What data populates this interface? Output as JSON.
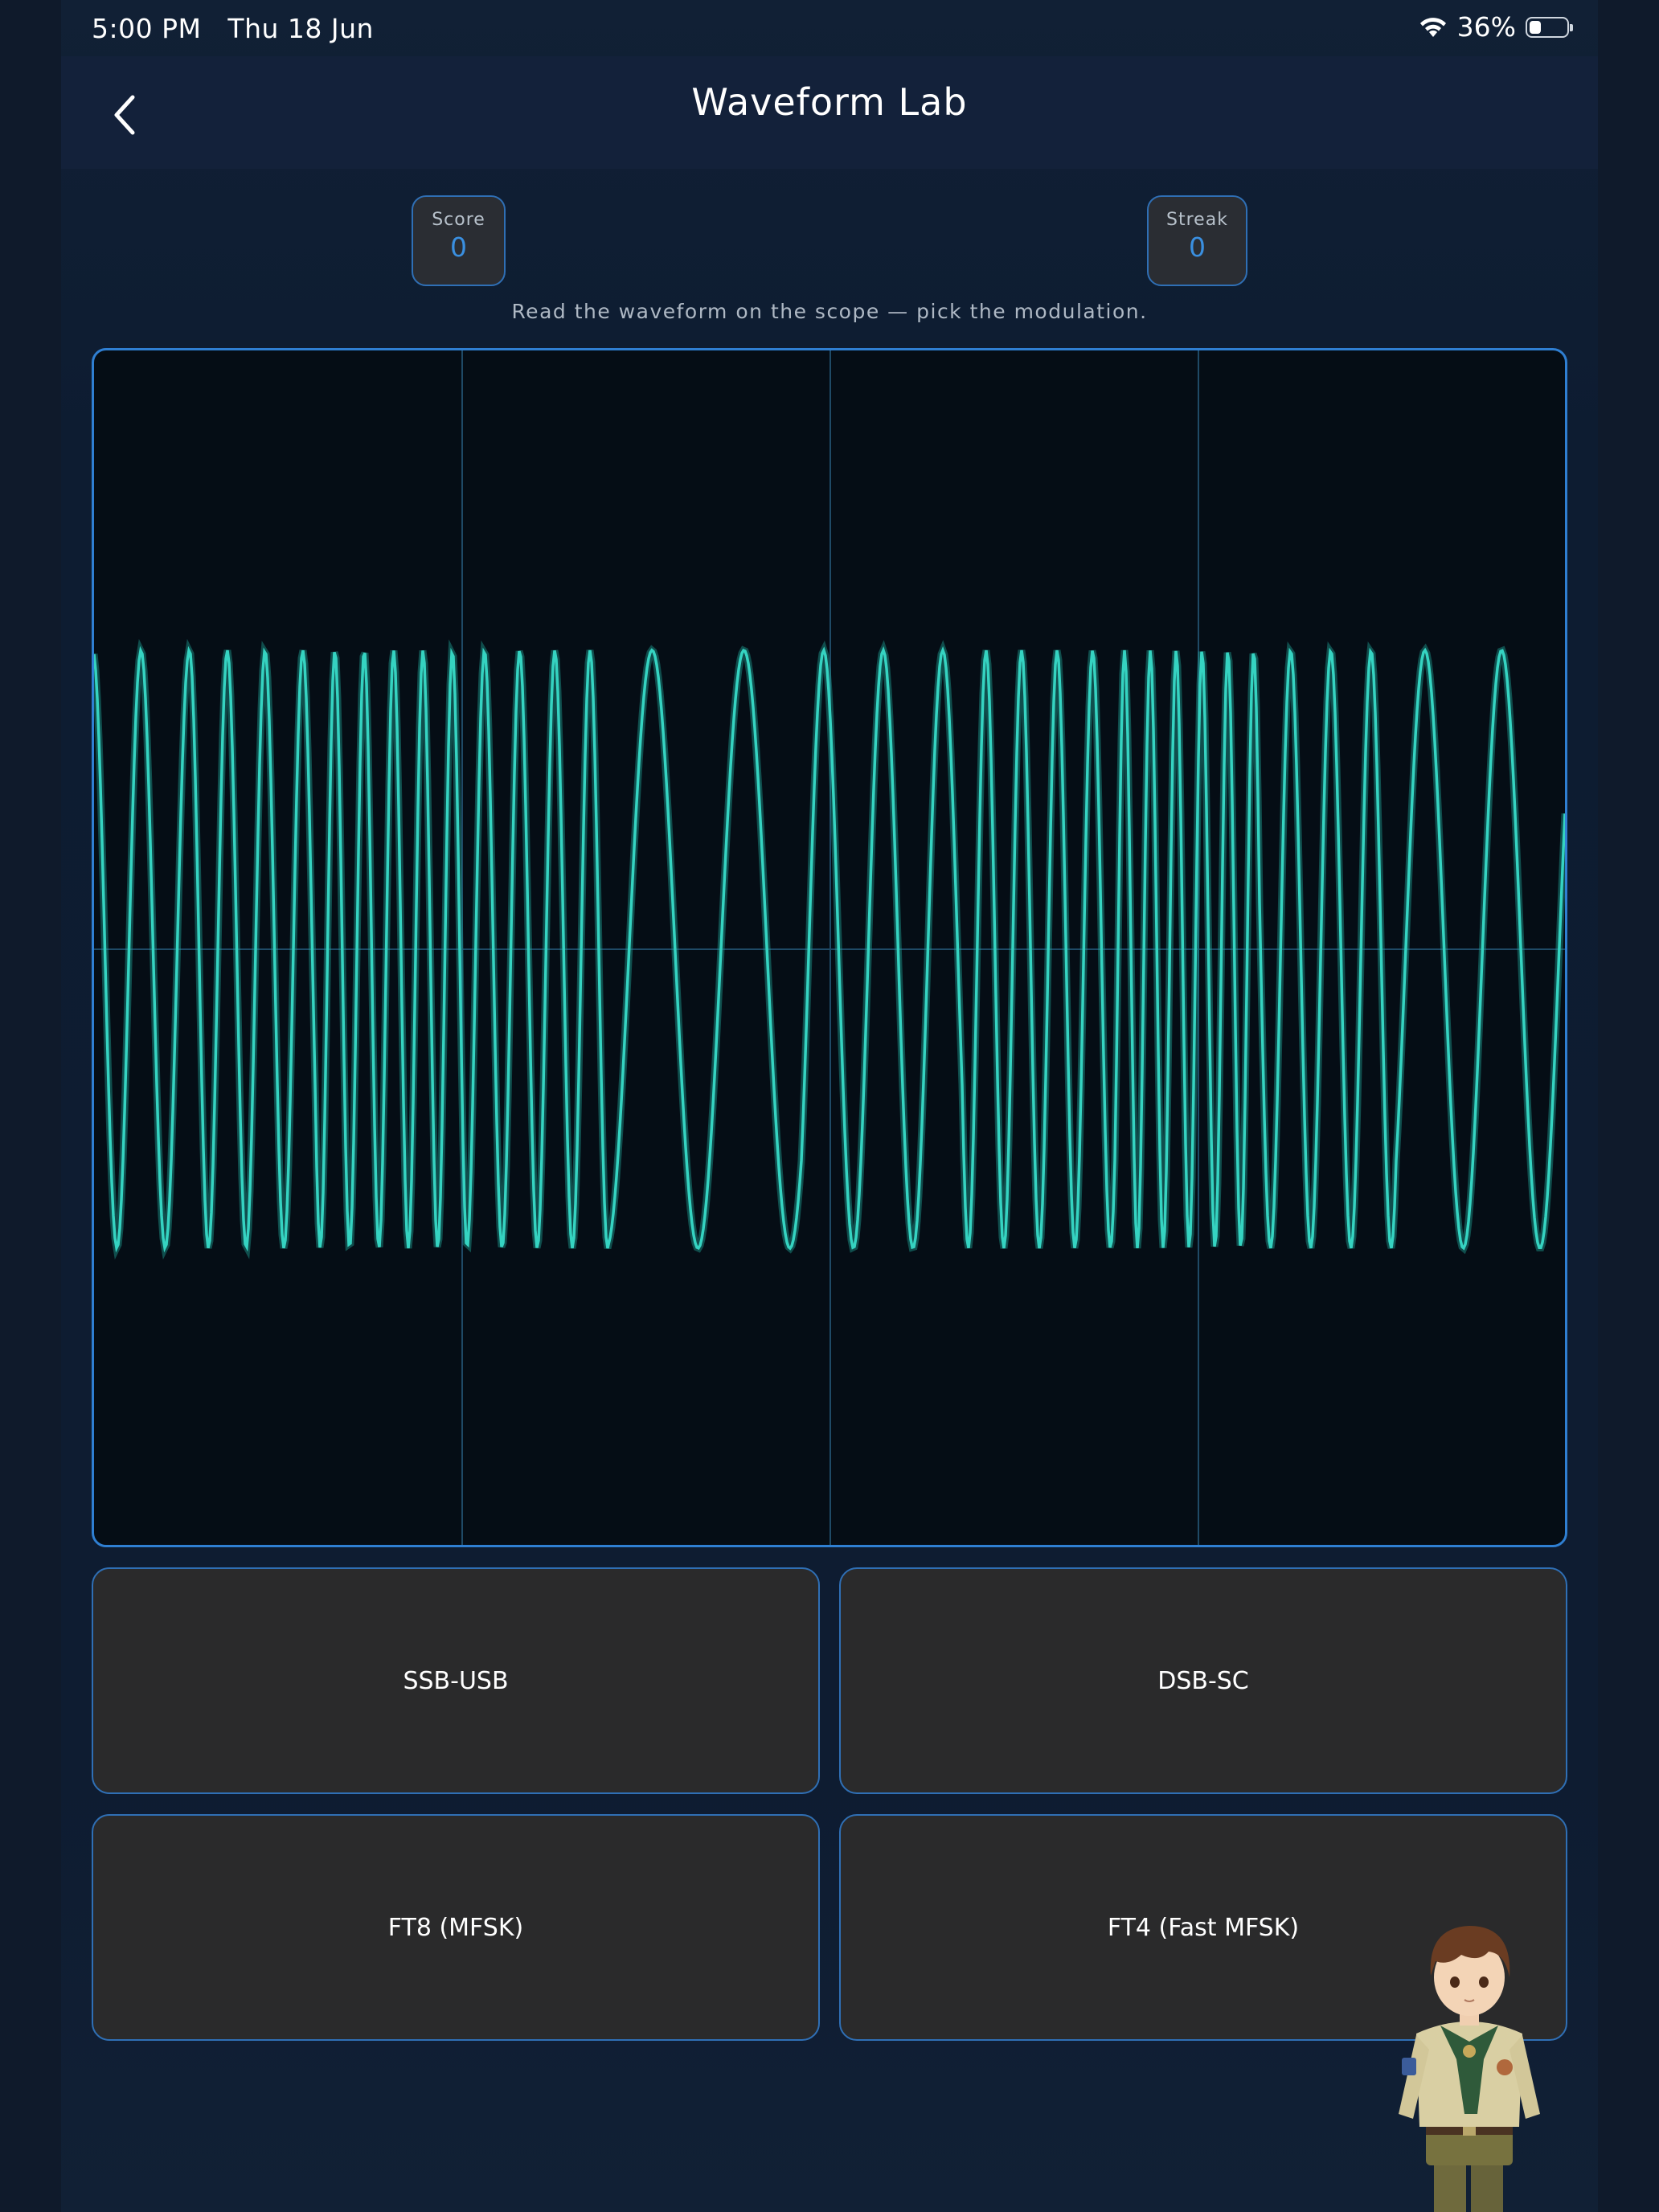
{
  "status_bar": {
    "time_date": "5:00 PM   Thu 18 Jun",
    "battery_percent": "36%",
    "icons": [
      "wifi-icon",
      "battery-icon"
    ]
  },
  "nav": {
    "title": "Waveform Lab",
    "back_icon": "chevron-left-icon"
  },
  "stats": {
    "score_label": "Score",
    "score_value": "0",
    "streak_label": "Streak",
    "streak_value": "0"
  },
  "instruction": "Read the waveform on the scope — pick the modulation.",
  "answers": [
    {
      "label": "SSB-USB"
    },
    {
      "label": "DSB-SC"
    },
    {
      "label": "FT8 (MFSK)"
    },
    {
      "label": "FT4 (Fast MFSK)"
    }
  ],
  "colors": {
    "trace": "#35d3c1",
    "accent": "#2f7fd2",
    "value": "#3a8fe0",
    "background": "#0f1a2b"
  }
}
